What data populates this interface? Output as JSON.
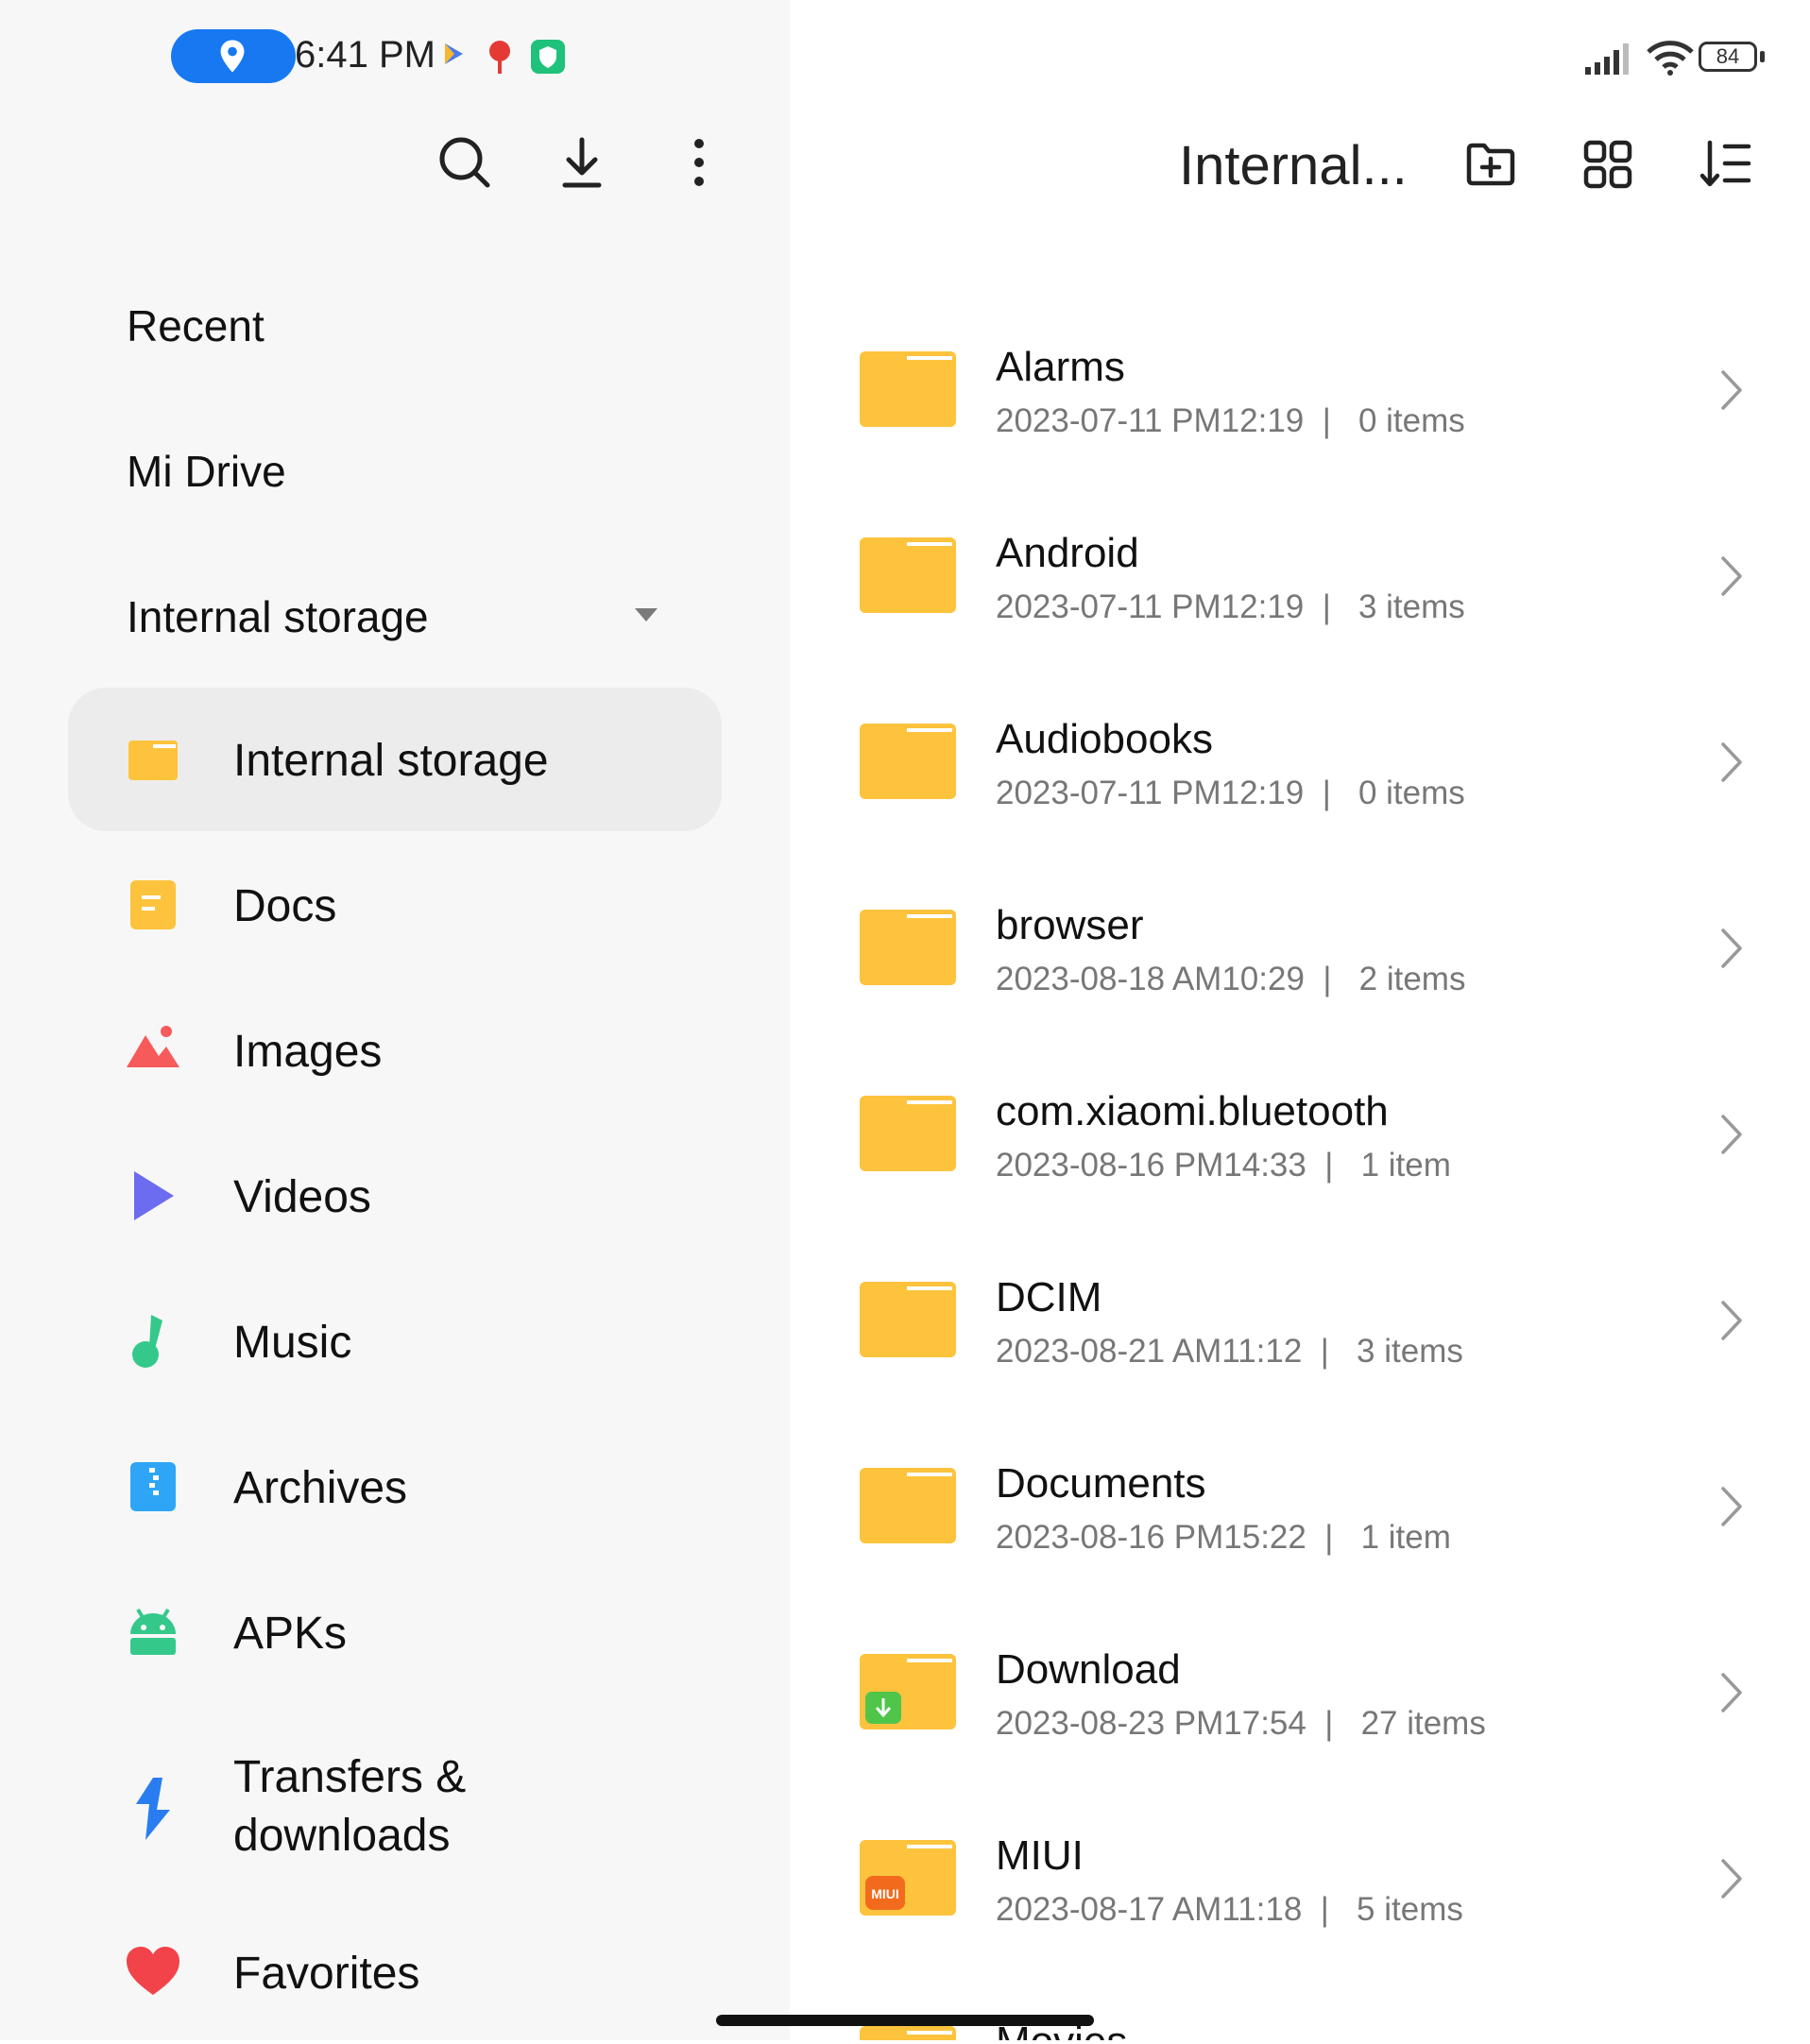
{
  "status_bar": {
    "time": "6:41 PM",
    "battery": "84",
    "icons": [
      "location-icon",
      "play-icon",
      "du-icon",
      "shield-icon",
      "signal-icon",
      "wifi-icon",
      "battery-icon"
    ]
  },
  "sidebar": {
    "sections": [
      {
        "label": "Recent"
      },
      {
        "label": "Mi Drive"
      },
      {
        "label": "Internal storage"
      }
    ],
    "items": [
      {
        "label": "Internal storage",
        "icon": "folder-icon",
        "selected": true
      },
      {
        "label": "Docs",
        "icon": "doc-icon"
      },
      {
        "label": "Images",
        "icon": "image-icon"
      },
      {
        "label": "Videos",
        "icon": "video-icon"
      },
      {
        "label": "Music",
        "icon": "music-icon"
      },
      {
        "label": "Archives",
        "icon": "archive-icon"
      },
      {
        "label": "APKs",
        "icon": "android-icon"
      },
      {
        "label": "Transfers &",
        "label2": "downloads",
        "icon": "transfer-icon"
      },
      {
        "label": "Favorites",
        "icon": "heart-icon"
      }
    ]
  },
  "main": {
    "title": "Internal...",
    "folders": [
      {
        "name": "Alarms",
        "date": "2023-07-11 PM12:19",
        "count": "0 items"
      },
      {
        "name": "Android",
        "date": "2023-07-11 PM12:19",
        "count": "3 items"
      },
      {
        "name": "Audiobooks",
        "date": "2023-07-11 PM12:19",
        "count": "0 items"
      },
      {
        "name": "browser",
        "date": "2023-08-18 AM10:29",
        "count": "2 items"
      },
      {
        "name": "com.xiaomi.bluetooth",
        "date": "2023-08-16 PM14:33",
        "count": "1 item"
      },
      {
        "name": "DCIM",
        "date": "2023-08-21 AM11:12",
        "count": "3 items"
      },
      {
        "name": "Documents",
        "date": "2023-08-16 PM15:22",
        "count": "1 item"
      },
      {
        "name": "Download",
        "date": "2023-08-23 PM17:54",
        "count": "27 items",
        "badge": "download"
      },
      {
        "name": "MIUI",
        "date": "2023-08-17 AM11:18",
        "count": "5 items",
        "badge": "MIUI"
      },
      {
        "name": "Movies",
        "date": "",
        "count": ""
      }
    ]
  },
  "colors": {
    "folder": "#fdc33d",
    "accent": "#1778f2"
  }
}
